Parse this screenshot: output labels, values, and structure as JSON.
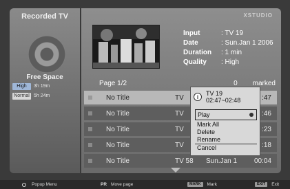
{
  "left": {
    "title": "Recorded TV",
    "free_space_label": "Free Space",
    "qualities": [
      {
        "label": "High",
        "time": "3h  19m"
      },
      {
        "label": "Normal",
        "time": "5h  24m"
      }
    ]
  },
  "brand": "XSTUDIO",
  "info": {
    "input_key": "Input",
    "input_val": ": TV 19",
    "date_key": "Date",
    "date_val": ": Sun.Jan 1 2006",
    "duration_key": "Duration",
    "duration_val": ": 1 min",
    "quality_key": "Quality",
    "quality_val": ": High"
  },
  "list": {
    "page_label": "Page  1/2",
    "marked_count": "0",
    "marked_label": "marked",
    "rows": [
      {
        "title": "No Title",
        "channel": "TV",
        "date": "",
        "time": ":47"
      },
      {
        "title": "No Title",
        "channel": "TV",
        "date": "",
        "time": ":46"
      },
      {
        "title": "No Title",
        "channel": "TV",
        "date": "",
        "time": ":23"
      },
      {
        "title": "No Title",
        "channel": "TV",
        "date": "",
        "time": ":18"
      },
      {
        "title": "No Title",
        "channel": "TV 58",
        "date": "Sun.Jan 1",
        "time": "00:04"
      }
    ]
  },
  "popup": {
    "channel": "TV 19",
    "time_range": "02:47~02:48",
    "items": [
      "Play",
      "Mark All",
      "Delete",
      "Rename",
      "Cancel"
    ]
  },
  "footer": {
    "popup_menu": "Popup Menu",
    "pr_key": "PR",
    "move_page": "Move page",
    "mark_key": "MARK",
    "mark": "Mark",
    "exit_key": "EXIT",
    "exit": "Exit"
  },
  "colors": {
    "background": "#3a3a3a",
    "panel": "#8e8e8e",
    "highlight_row": "#b8b8b8",
    "popup_bg": "#d8d8d8",
    "quality_selected": "#9fb7d8"
  }
}
